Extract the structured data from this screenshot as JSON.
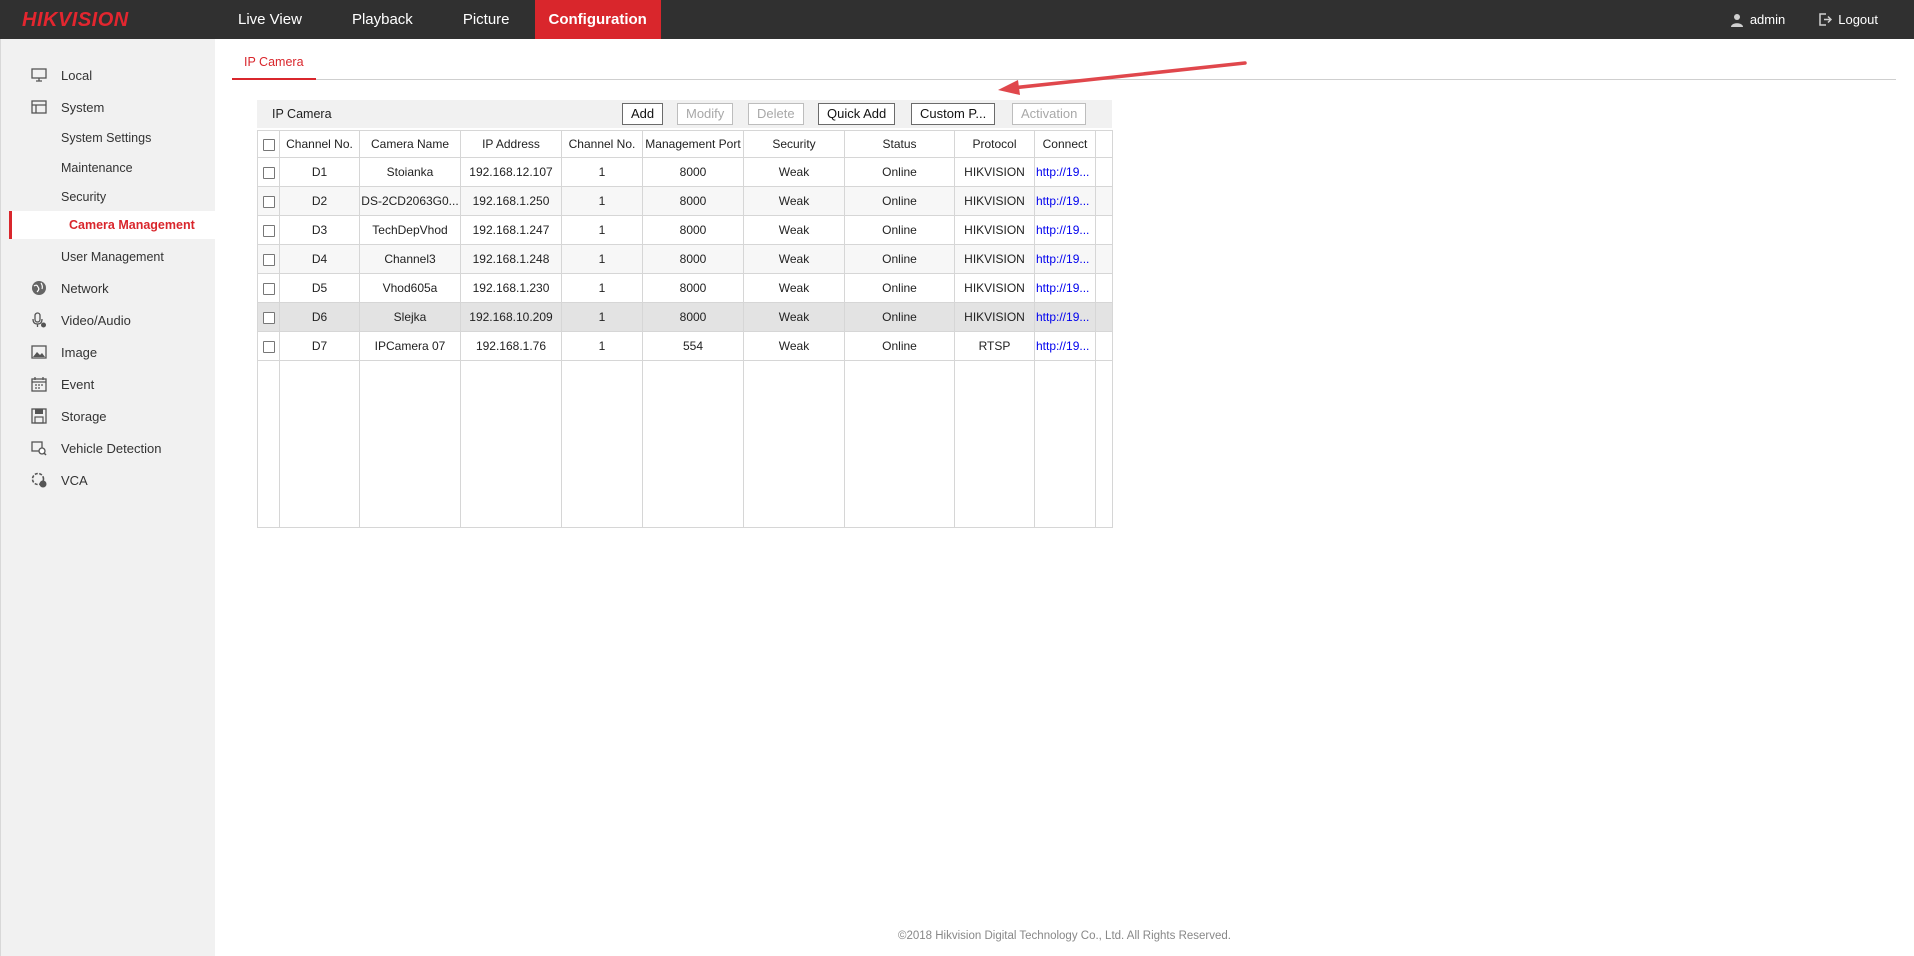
{
  "brand": {
    "logo_text": "HIKVISION",
    "accent_color": "#d9262c"
  },
  "nav": {
    "items": [
      {
        "label": "Live View"
      },
      {
        "label": "Playback"
      },
      {
        "label": "Picture"
      },
      {
        "label": "Configuration",
        "active": true
      }
    ]
  },
  "user": {
    "name": "admin",
    "logout_label": "Logout"
  },
  "sidebar": {
    "items": [
      {
        "label": "Local",
        "icon": "monitor-icon"
      },
      {
        "label": "System",
        "icon": "system-icon"
      },
      {
        "label": "System Settings",
        "sub": true
      },
      {
        "label": "Maintenance",
        "sub": true
      },
      {
        "label": "Security",
        "sub": true
      },
      {
        "label": "Camera Management",
        "sub": true,
        "active": true
      },
      {
        "label": "User Management",
        "sub": true
      },
      {
        "label": "Network",
        "icon": "globe-icon"
      },
      {
        "label": "Video/Audio",
        "icon": "microphone-icon"
      },
      {
        "label": "Image",
        "icon": "image-icon"
      },
      {
        "label": "Event",
        "icon": "calendar-icon"
      },
      {
        "label": "Storage",
        "icon": "storage-icon"
      },
      {
        "label": "Vehicle Detection",
        "icon": "vehicle-search-icon"
      },
      {
        "label": "VCA",
        "icon": "vca-icon"
      }
    ]
  },
  "tab": {
    "label": "IP Camera"
  },
  "toolbar": {
    "title": "IP Camera",
    "buttons": {
      "add": "Add",
      "modify": "Modify",
      "delete": "Delete",
      "quick_add": "Quick Add",
      "custom": "Custom P...",
      "activation": "Activation"
    }
  },
  "table": {
    "columns": [
      "Channel No.",
      "Camera Name",
      "IP Address",
      "Channel No.",
      "Management Port",
      "Security",
      "Status",
      "Protocol",
      "Connect"
    ],
    "rows": [
      [
        "D1",
        "Stoianka",
        "192.168.12.107",
        "1",
        "8000",
        "Weak",
        "Online",
        "HIKVISION",
        "http://19..."
      ],
      [
        "D2",
        "DS-2CD2063G0...",
        "192.168.1.250",
        "1",
        "8000",
        "Weak",
        "Online",
        "HIKVISION",
        "http://19..."
      ],
      [
        "D3",
        "TechDepVhod",
        "192.168.1.247",
        "1",
        "8000",
        "Weak",
        "Online",
        "HIKVISION",
        "http://19..."
      ],
      [
        "D4",
        "Channel3",
        "192.168.1.248",
        "1",
        "8000",
        "Weak",
        "Online",
        "HIKVISION",
        "http://19..."
      ],
      [
        "D5",
        "Vhod605a",
        "192.168.1.230",
        "1",
        "8000",
        "Weak",
        "Online",
        "HIKVISION",
        "http://19..."
      ],
      [
        "D6",
        "Slejka",
        "192.168.10.209",
        "1",
        "8000",
        "Weak",
        "Online",
        "HIKVISION",
        "http://19..."
      ],
      [
        "D7",
        "IPCamera 07",
        "192.168.1.76",
        "1",
        "554",
        "Weak",
        "Online",
        "RTSP",
        "http://19..."
      ]
    ],
    "selected_row": 5
  },
  "footer": {
    "copyright": "©2018 Hikvision Digital Technology Co., Ltd. All Rights Reserved."
  }
}
